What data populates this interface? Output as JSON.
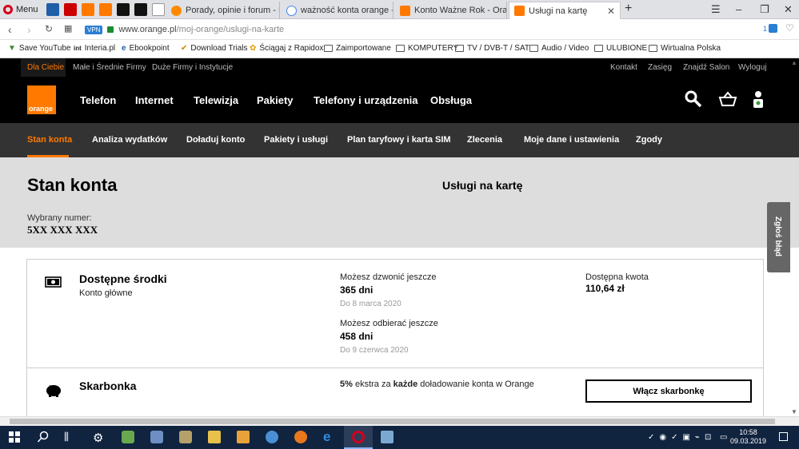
{
  "browser": {
    "menu_label": "Menu",
    "tabs": [
      {
        "title": "Porady, opinie i forum - N"
      },
      {
        "title": "ważność konta orange - S"
      },
      {
        "title": "Konto Ważne Rok - Orang"
      },
      {
        "title": "Usługi na kartę"
      }
    ],
    "new_tab": "+",
    "url_prefix": "www.orange.pl",
    "url_path": "/moj-orange/uslugi-na-karte",
    "vpn_label": "VPN",
    "ext_badge": "1"
  },
  "bookmarks": [
    "Save YouTube",
    "Interia.pl",
    "Ebookpoint",
    "Download Trials",
    "Ściągaj z Rapidox",
    "Zaimportowane",
    "KOMPUTERY",
    "TV / DVB-T / SAT",
    "Audio / Video",
    "ULUBIONE",
    "Wirtualna Polska"
  ],
  "top_nav": {
    "left": [
      "Dla Ciebie",
      "Małe i Średnie Firmy",
      "Duże Firmy i Instytucje"
    ],
    "right": [
      "Kontakt",
      "Zasięg",
      "Znajdź Salon",
      "Wyloguj"
    ]
  },
  "logo_text": "orange",
  "main_nav": [
    "Telefon",
    "Internet",
    "Telewizja",
    "Pakiety",
    "Telefony i urządzenia",
    "Obsługa"
  ],
  "sub_nav": [
    "Stan konta",
    "Analiza wydatków",
    "Doładuj konto",
    "Pakiety i usługi",
    "Plan taryfowy i karta SIM",
    "Zlecenia",
    "Moje dane i ustawienia",
    "Zgody"
  ],
  "hero": {
    "title": "Stan konta",
    "subtitle": "Usługi na kartę",
    "number_label": "Wybrany numer:",
    "number": "5XX XXX XXX"
  },
  "funds": {
    "title": "Dostępne środki",
    "subtitle": "Konto główne",
    "call_label": "Możesz dzwonić jeszcze",
    "call_days": "365 dni",
    "call_until": "Do 8 marca 2020",
    "receive_label": "Możesz odbierać jeszcze",
    "receive_days": "458 dni",
    "receive_until": "Do 9 czerwca 2020",
    "amount_label": "Dostępna kwota",
    "amount": "110,64 zł"
  },
  "piggy": {
    "title": "Skarbonka",
    "desc_pct": "5%",
    "desc_mid": " ekstra za ",
    "desc_bold": "każde",
    "desc_end": " doładowanie konta w Orange",
    "button": "Włącz skarbonkę"
  },
  "feedback": "Zgłoś błąd",
  "taskbar": {
    "time": "10:58",
    "date": "09.03.2019"
  },
  "colors": {
    "accent": "#ff7900",
    "nav_bg": "#000000",
    "subnav_bg": "#333333",
    "hero_bg": "#dddddd"
  }
}
